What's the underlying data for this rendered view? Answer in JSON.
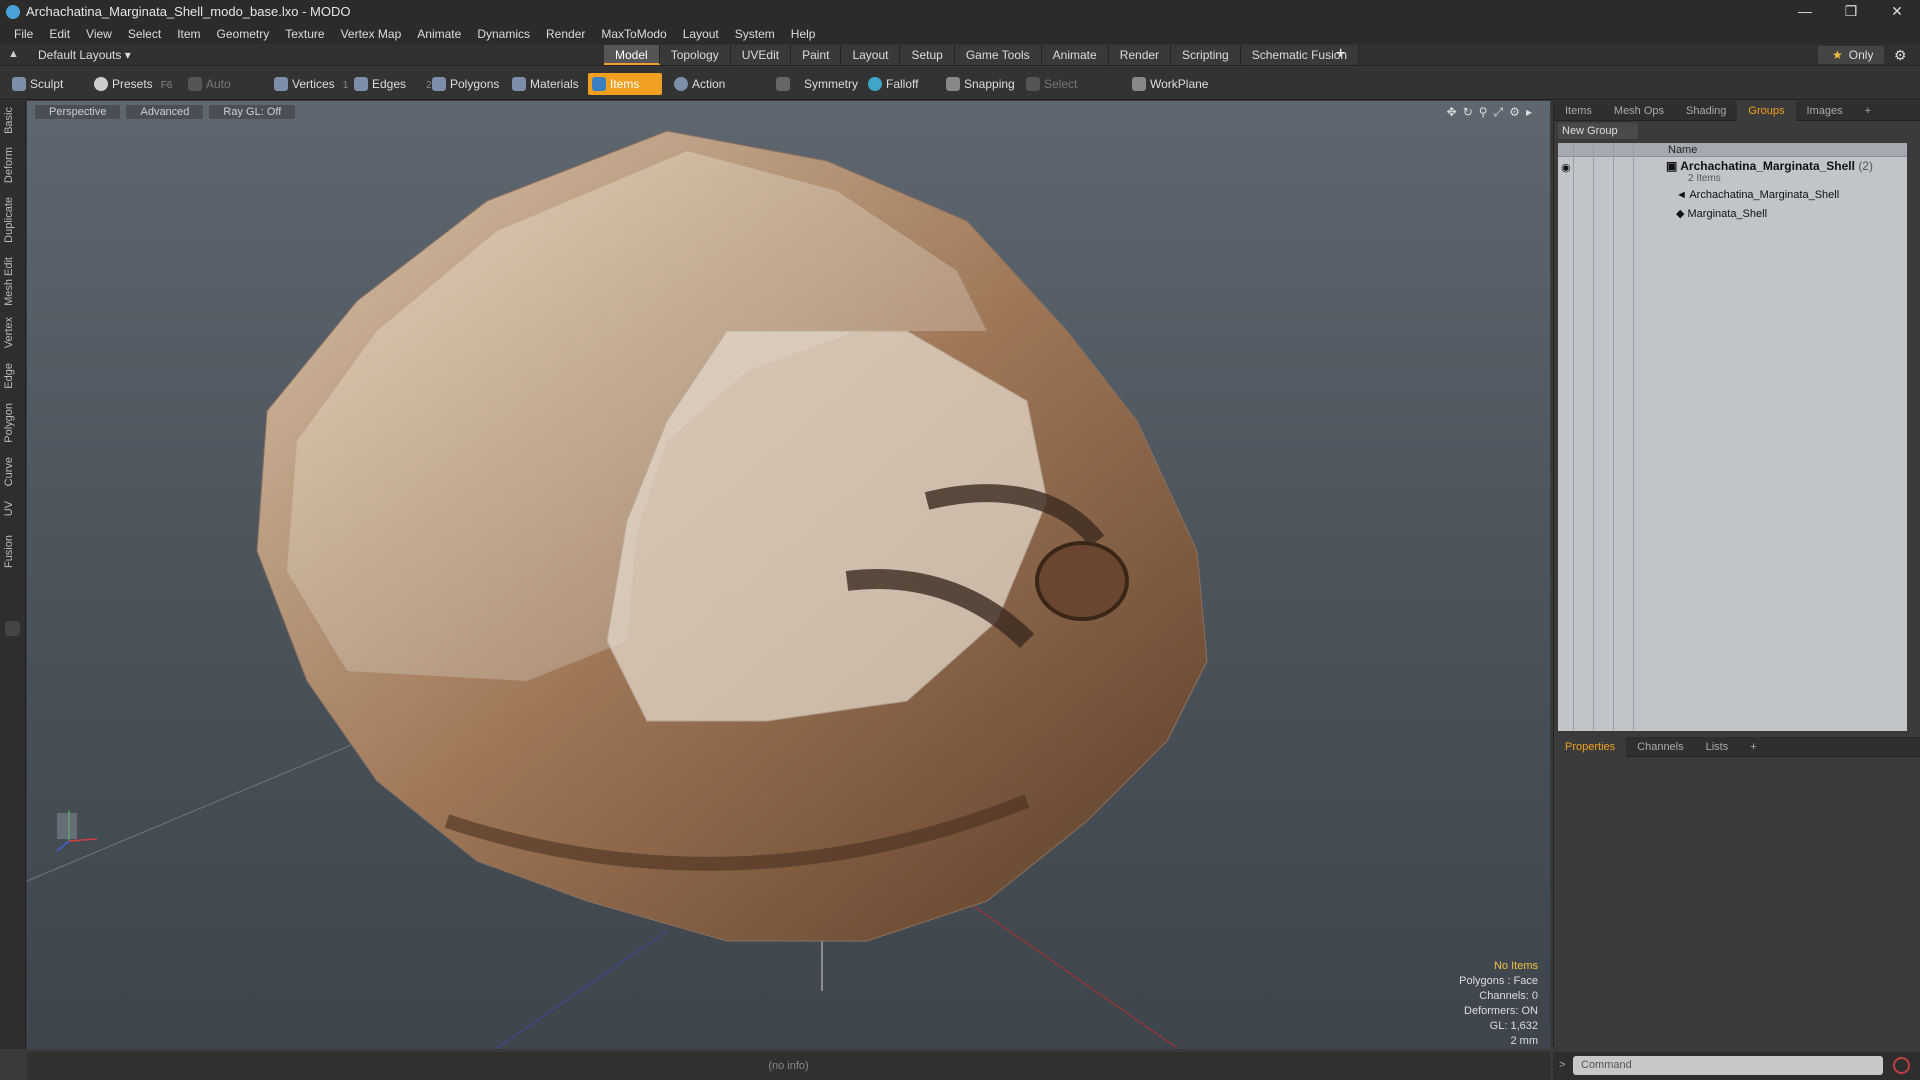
{
  "window": {
    "title": "Archachatina_Marginata_Shell_modo_base.lxo - MODO",
    "controls": [
      "—",
      "❒",
      "✕"
    ]
  },
  "menu": [
    "File",
    "Edit",
    "View",
    "Select",
    "Item",
    "Geometry",
    "Texture",
    "Vertex Map",
    "Animate",
    "Dynamics",
    "Render",
    "MaxToModo",
    "Layout",
    "System",
    "Help"
  ],
  "layoutbar": {
    "layout_dropdown": "Default Layouts ▾",
    "tabs": [
      "Model",
      "Topology",
      "UVEdit",
      "Paint",
      "Layout",
      "Setup",
      "Game Tools",
      "Animate",
      "Render",
      "Scripting",
      "Schematic Fusion"
    ],
    "active_tab": "Model",
    "add_tab": "+",
    "only_label": "Only"
  },
  "toolbar": {
    "sculpt": "Sculpt",
    "presets": "Presets",
    "presets_key": "F6",
    "auto_select": "Auto Select",
    "vertices": "Vertices",
    "vertices_count": "1",
    "edges": "Edges",
    "edges_count": "2",
    "polygons": "Polygons",
    "materials": "Materials",
    "items": "Items",
    "action_center": "Action Center",
    "symmetry": "Symmetry",
    "falloff": "Falloff",
    "snapping": "Snapping",
    "select_through": "Select Through",
    "workplane": "WorkPlane"
  },
  "left_tabs": [
    "Basic",
    "Deform",
    "Duplicate",
    "Mesh Edit",
    "Vertex",
    "Edge",
    "Polygon",
    "Curve",
    "UV",
    "Fusion"
  ],
  "viewport": {
    "view_mode": "Perspective",
    "shading": "Advanced",
    "raygl": "Ray GL: Off",
    "stats": {
      "selection": "No Items",
      "polygons": "Polygons : Face",
      "channels": "Channels: 0",
      "deformers": "Deformers: ON",
      "gl": "GL: 1,632",
      "scale": "2 mm"
    }
  },
  "groups_panel": {
    "tabs": [
      "Items",
      "Mesh Ops",
      "Shading",
      "Groups",
      "Images",
      "+"
    ],
    "active_tab": "Groups",
    "new_group": "New Group",
    "column_name": "Name",
    "group": {
      "name": "Archachatina_Marginata_Shell",
      "count": "(2)",
      "sub": "2 Items",
      "children": [
        "Archachatina_Marginata_Shell",
        "Marginata_Shell"
      ]
    }
  },
  "props_panel": {
    "tabs": [
      "Properties",
      "Channels",
      "Lists",
      "+"
    ],
    "active_tab": "Properties"
  },
  "statusbar": {
    "info": "(no info)"
  },
  "command": {
    "prompt": ">",
    "placeholder": "Command"
  }
}
